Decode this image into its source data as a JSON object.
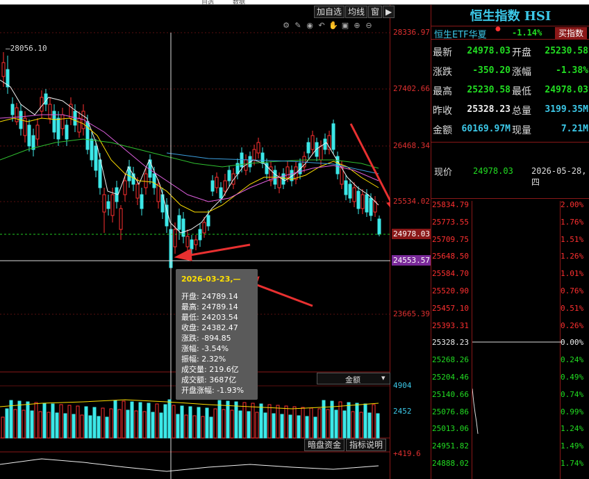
{
  "menu": {
    "item_a": "自选",
    "item_b": "数据"
  },
  "toolbar": {
    "add_watch": "加自选",
    "ma_line": "均线",
    "window": "窗",
    "nav": "▶"
  },
  "axis_labels": [
    "28336.97",
    "27402.66",
    "26468.34",
    "25534.02",
    "24978.03",
    "24553.57",
    "23665.39"
  ],
  "peak_label": "28056.10",
  "current_price_box": "24978.03",
  "cursor_price_box": "24553.57",
  "tooltip": {
    "date": "2026-03-23,—",
    "lines": [
      "开盘: 24789.14",
      "最高: 24789.14",
      "最低: 24203.54",
      "收盘: 24382.47",
      "涨跌: -894.85",
      "涨幅: -3.54%",
      "振幅: 2.32%",
      "成交量: 219.6亿",
      "成交额: 3687亿",
      "开盘涨幅: -1.93%"
    ]
  },
  "volume_panel": {
    "select_value": "金额",
    "axis_top": "4904",
    "axis_mid": "2452"
  },
  "bottom_buttons": {
    "dark_pool": "暗盘资金",
    "indicator_help": "指标说明"
  },
  "macd_axis_top": "+419.6",
  "right_panel": {
    "title": "恒生指数 HSI",
    "etf_name": "恒生ETF华夏",
    "etf_change": "-1.14%",
    "buy_button": "买指数",
    "quotes": [
      {
        "l1": "最新",
        "v1": "24978.03",
        "c1": "green",
        "l2": "开盘",
        "v2": "25230.58",
        "c2": "green"
      },
      {
        "l1": "涨跌",
        "v1": "-350.20",
        "c1": "green",
        "l2": "涨幅",
        "v2": "-1.38%",
        "c2": "green"
      },
      {
        "l1": "最高",
        "v1": "25230.58",
        "c1": "green",
        "l2": "最低",
        "v2": "24978.03",
        "c2": "green"
      },
      {
        "l1": "昨收",
        "v1": "25328.23",
        "c1": "white",
        "l2": "总量",
        "v2": "3199.35M",
        "c2": "cyan"
      },
      {
        "l1": "金额",
        "v1": "60169.97M",
        "c1": "cyan",
        "l2": "现量",
        "v2": "7.21M",
        "c2": "cyan"
      }
    ],
    "current_label": "现价",
    "current_value": "24978.03",
    "current_date": "2026-05-28,四",
    "intraday_prices": [
      "25834.79",
      "25773.55",
      "25709.75",
      "25648.50",
      "25584.70",
      "25520.90",
      "25457.10",
      "25393.31",
      "25328.23",
      "25268.26",
      "25204.46",
      "25140.66",
      "25076.86",
      "25013.06",
      "24951.82",
      "24888.02"
    ],
    "intraday_pcts": [
      "2.00%",
      "1.76%",
      "1.51%",
      "1.26%",
      "1.01%",
      "0.76%",
      "0.51%",
      "0.26%",
      "0.00%",
      "0.24%",
      "0.49%",
      "0.74%",
      "0.99%",
      "1.24%",
      "1.49%",
      "1.74%"
    ]
  },
  "colors": {
    "up": "#ff3030",
    "down": "#22dd22",
    "bear_candle": "#3ce8e8",
    "grid": "#8a1818",
    "accent": "#3cc8e8"
  }
}
